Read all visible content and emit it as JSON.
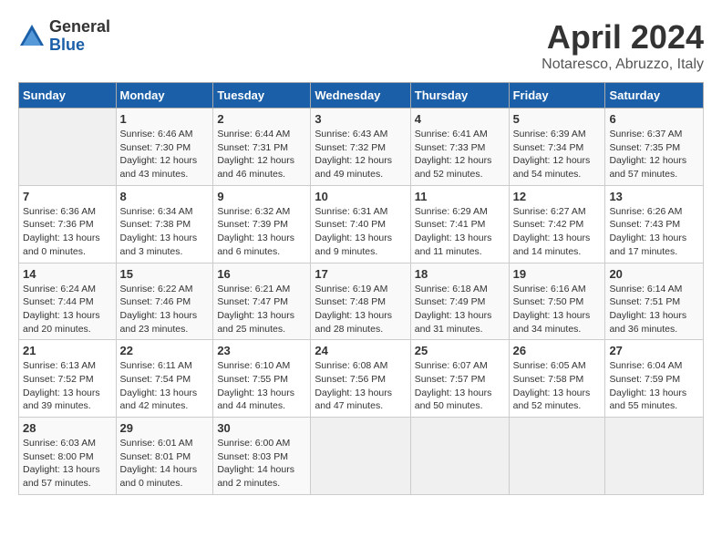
{
  "logo": {
    "general": "General",
    "blue": "Blue"
  },
  "title": "April 2024",
  "subtitle": "Notaresco, Abruzzo, Italy",
  "headers": [
    "Sunday",
    "Monday",
    "Tuesday",
    "Wednesday",
    "Thursday",
    "Friday",
    "Saturday"
  ],
  "weeks": [
    [
      {
        "day": "",
        "info": ""
      },
      {
        "day": "1",
        "info": "Sunrise: 6:46 AM\nSunset: 7:30 PM\nDaylight: 12 hours\nand 43 minutes."
      },
      {
        "day": "2",
        "info": "Sunrise: 6:44 AM\nSunset: 7:31 PM\nDaylight: 12 hours\nand 46 minutes."
      },
      {
        "day": "3",
        "info": "Sunrise: 6:43 AM\nSunset: 7:32 PM\nDaylight: 12 hours\nand 49 minutes."
      },
      {
        "day": "4",
        "info": "Sunrise: 6:41 AM\nSunset: 7:33 PM\nDaylight: 12 hours\nand 52 minutes."
      },
      {
        "day": "5",
        "info": "Sunrise: 6:39 AM\nSunset: 7:34 PM\nDaylight: 12 hours\nand 54 minutes."
      },
      {
        "day": "6",
        "info": "Sunrise: 6:37 AM\nSunset: 7:35 PM\nDaylight: 12 hours\nand 57 minutes."
      }
    ],
    [
      {
        "day": "7",
        "info": "Sunrise: 6:36 AM\nSunset: 7:36 PM\nDaylight: 13 hours\nand 0 minutes."
      },
      {
        "day": "8",
        "info": "Sunrise: 6:34 AM\nSunset: 7:38 PM\nDaylight: 13 hours\nand 3 minutes."
      },
      {
        "day": "9",
        "info": "Sunrise: 6:32 AM\nSunset: 7:39 PM\nDaylight: 13 hours\nand 6 minutes."
      },
      {
        "day": "10",
        "info": "Sunrise: 6:31 AM\nSunset: 7:40 PM\nDaylight: 13 hours\nand 9 minutes."
      },
      {
        "day": "11",
        "info": "Sunrise: 6:29 AM\nSunset: 7:41 PM\nDaylight: 13 hours\nand 11 minutes."
      },
      {
        "day": "12",
        "info": "Sunrise: 6:27 AM\nSunset: 7:42 PM\nDaylight: 13 hours\nand 14 minutes."
      },
      {
        "day": "13",
        "info": "Sunrise: 6:26 AM\nSunset: 7:43 PM\nDaylight: 13 hours\nand 17 minutes."
      }
    ],
    [
      {
        "day": "14",
        "info": "Sunrise: 6:24 AM\nSunset: 7:44 PM\nDaylight: 13 hours\nand 20 minutes."
      },
      {
        "day": "15",
        "info": "Sunrise: 6:22 AM\nSunset: 7:46 PM\nDaylight: 13 hours\nand 23 minutes."
      },
      {
        "day": "16",
        "info": "Sunrise: 6:21 AM\nSunset: 7:47 PM\nDaylight: 13 hours\nand 25 minutes."
      },
      {
        "day": "17",
        "info": "Sunrise: 6:19 AM\nSunset: 7:48 PM\nDaylight: 13 hours\nand 28 minutes."
      },
      {
        "day": "18",
        "info": "Sunrise: 6:18 AM\nSunset: 7:49 PM\nDaylight: 13 hours\nand 31 minutes."
      },
      {
        "day": "19",
        "info": "Sunrise: 6:16 AM\nSunset: 7:50 PM\nDaylight: 13 hours\nand 34 minutes."
      },
      {
        "day": "20",
        "info": "Sunrise: 6:14 AM\nSunset: 7:51 PM\nDaylight: 13 hours\nand 36 minutes."
      }
    ],
    [
      {
        "day": "21",
        "info": "Sunrise: 6:13 AM\nSunset: 7:52 PM\nDaylight: 13 hours\nand 39 minutes."
      },
      {
        "day": "22",
        "info": "Sunrise: 6:11 AM\nSunset: 7:54 PM\nDaylight: 13 hours\nand 42 minutes."
      },
      {
        "day": "23",
        "info": "Sunrise: 6:10 AM\nSunset: 7:55 PM\nDaylight: 13 hours\nand 44 minutes."
      },
      {
        "day": "24",
        "info": "Sunrise: 6:08 AM\nSunset: 7:56 PM\nDaylight: 13 hours\nand 47 minutes."
      },
      {
        "day": "25",
        "info": "Sunrise: 6:07 AM\nSunset: 7:57 PM\nDaylight: 13 hours\nand 50 minutes."
      },
      {
        "day": "26",
        "info": "Sunrise: 6:05 AM\nSunset: 7:58 PM\nDaylight: 13 hours\nand 52 minutes."
      },
      {
        "day": "27",
        "info": "Sunrise: 6:04 AM\nSunset: 7:59 PM\nDaylight: 13 hours\nand 55 minutes."
      }
    ],
    [
      {
        "day": "28",
        "info": "Sunrise: 6:03 AM\nSunset: 8:00 PM\nDaylight: 13 hours\nand 57 minutes."
      },
      {
        "day": "29",
        "info": "Sunrise: 6:01 AM\nSunset: 8:01 PM\nDaylight: 14 hours\nand 0 minutes."
      },
      {
        "day": "30",
        "info": "Sunrise: 6:00 AM\nSunset: 8:03 PM\nDaylight: 14 hours\nand 2 minutes."
      },
      {
        "day": "",
        "info": ""
      },
      {
        "day": "",
        "info": ""
      },
      {
        "day": "",
        "info": ""
      },
      {
        "day": "",
        "info": ""
      }
    ]
  ]
}
